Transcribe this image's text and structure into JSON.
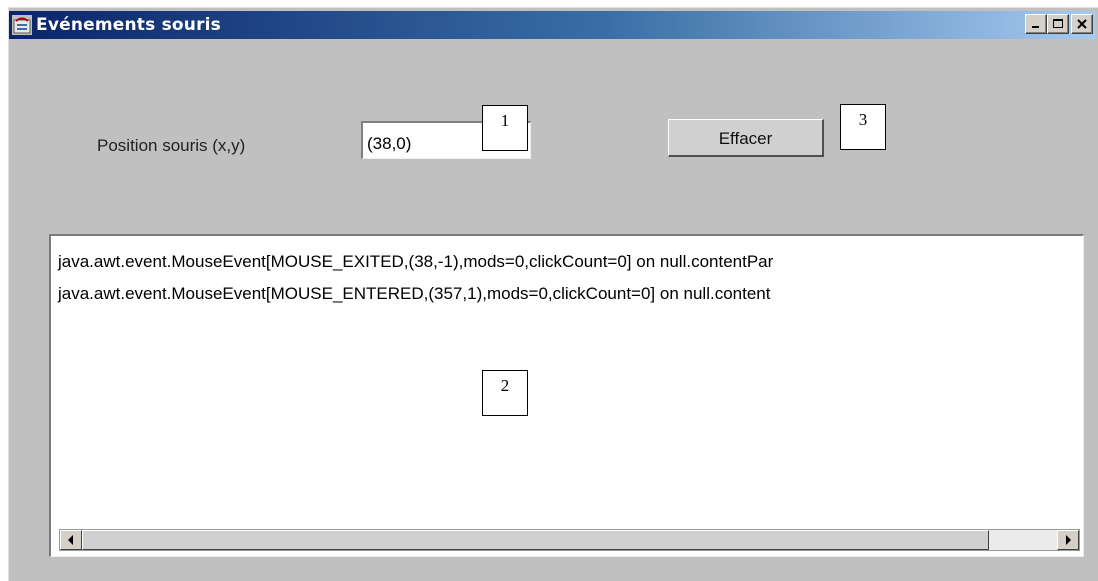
{
  "window": {
    "title": "Evénements souris",
    "controls": [
      "minimize-icon",
      "maximize-icon",
      "close-icon"
    ]
  },
  "position": {
    "label": "Position souris (x,y)",
    "value": "(38,0)"
  },
  "clear_button": {
    "label": "Effacer"
  },
  "log": {
    "lines": [
      "java.awt.event.MouseEvent[MOUSE_EXITED,(38,-1),mods=0,clickCount=0] on null.contentPar",
      "java.awt.event.MouseEvent[MOUSE_ENTERED,(357,1),mods=0,clickCount=0] on null.content"
    ]
  },
  "callouts": {
    "field": "1",
    "log": "2",
    "button": "3"
  },
  "scrollbar": {
    "left_arrow": "arrow-left-icon",
    "right_arrow": "arrow-right-icon"
  }
}
